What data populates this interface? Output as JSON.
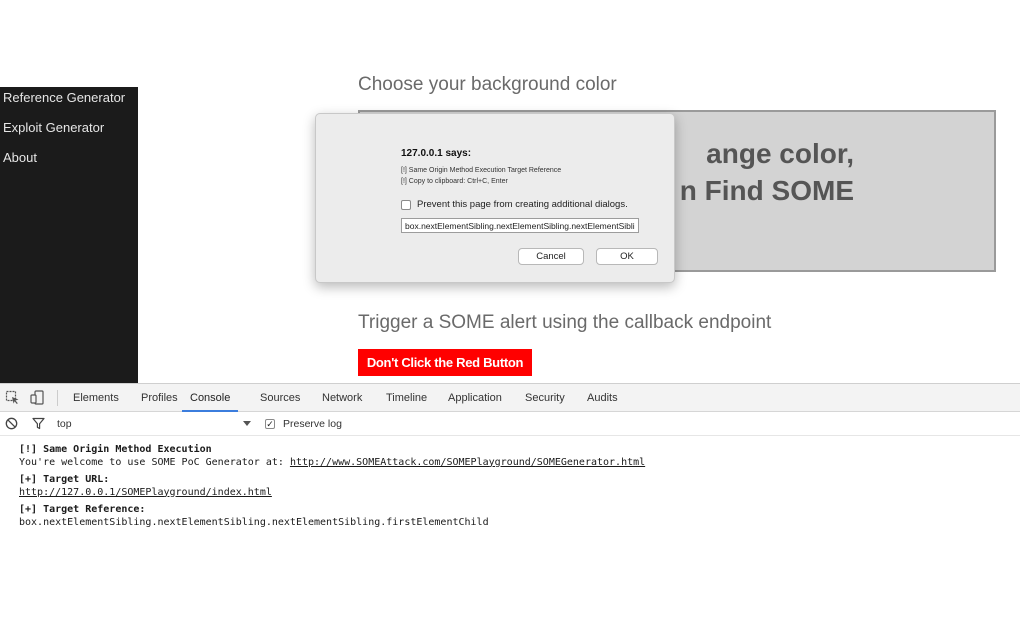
{
  "sidebar": {
    "items": [
      {
        "label": "Reference Generator"
      },
      {
        "label": "Exploit Generator"
      },
      {
        "label": "About"
      }
    ]
  },
  "page": {
    "heading": "Choose your background color",
    "box_line1": "ange color,",
    "box_line2": "n Find SOME",
    "trigger_text": "Trigger a SOME alert using the callback endpoint",
    "red_button": "Don't Click the Red Button"
  },
  "dialog": {
    "title": "127.0.0.1 says:",
    "message_line1": "[!] Same Origin Method Execution Target Reference",
    "message_line2": "[!] Copy to clipboard: Ctrl+C, Enter",
    "checkbox_label": "Prevent this page from creating additional dialogs.",
    "input_value": "box.nextElementSibling.nextElementSibling.nextElementSibling.firstElementChild",
    "cancel_label": "Cancel",
    "ok_label": "OK"
  },
  "devtools": {
    "tabs": [
      {
        "label": "Elements"
      },
      {
        "label": "Profiles"
      },
      {
        "label": "Console"
      },
      {
        "label": "Sources"
      },
      {
        "label": "Network"
      },
      {
        "label": "Timeline"
      },
      {
        "label": "Application"
      },
      {
        "label": "Security"
      },
      {
        "label": "Audits"
      }
    ],
    "active_tab": "Console",
    "context": "top",
    "preserve_log_label": "Preserve log",
    "preserve_log_checked": true,
    "accent_color": "#3b7ddd"
  },
  "console": {
    "line1": "[!] Same Origin Method Execution",
    "line2_prefix": "You're welcome to use SOME PoC Generator at: ",
    "line2_link": "http://www.SOMEAttack.com/SOMEPlayground/SOMEGenerator.html",
    "line3": "[+] Target URL:",
    "line4_link": "http://127.0.0.1/SOMEPlayground/index.html",
    "line5": "[+] Target Reference:",
    "line6": "box.nextElementSibling.nextElementSibling.nextElementSibling.firstElementChild"
  },
  "colors": {
    "sidebar_bg": "#1b1b1b",
    "red_button": "#ff0000",
    "color_box": "#d3d3d3"
  }
}
